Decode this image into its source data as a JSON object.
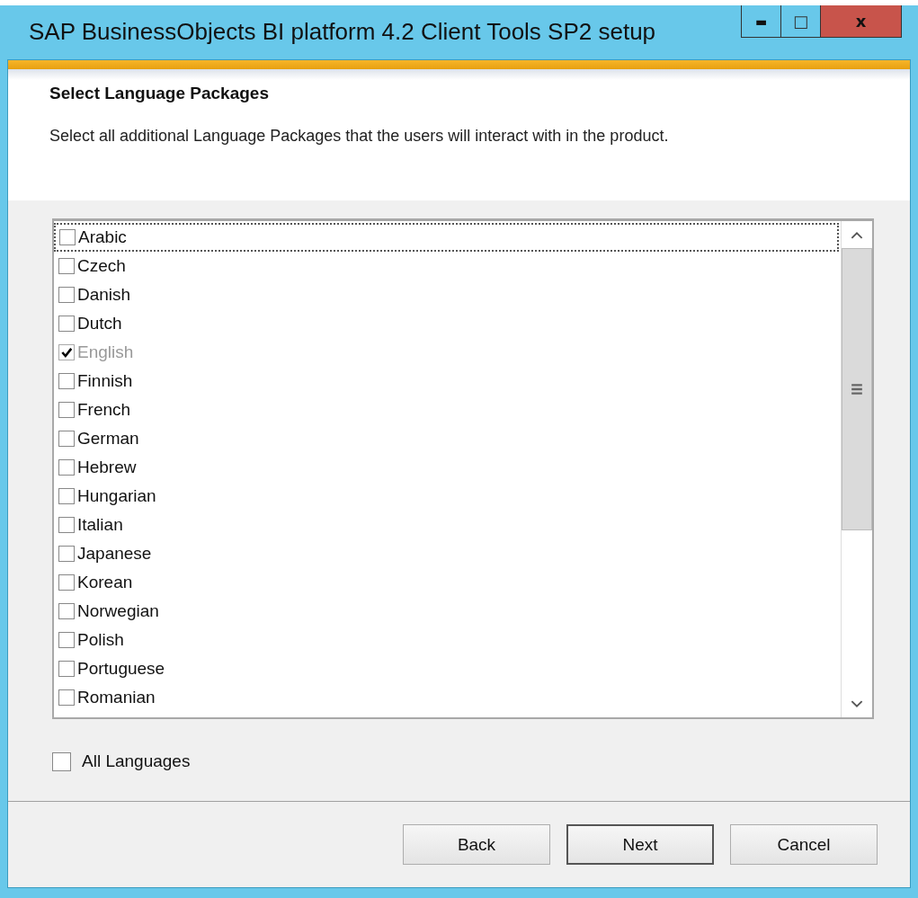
{
  "window": {
    "title": "SAP BusinessObjects BI platform 4.2 Client Tools SP2 setup",
    "controls": [
      {
        "kind": "minimize",
        "label": "▬"
      },
      {
        "kind": "maximize",
        "label": "□"
      },
      {
        "kind": "close",
        "label": "x"
      }
    ]
  },
  "header": {
    "title": "Select Language Packages",
    "description": "Select all additional Language Packages that the users will interact with in the product."
  },
  "languages": [
    {
      "label": "Arabic",
      "checked": false,
      "disabled": false,
      "focused": true
    },
    {
      "label": "Czech",
      "checked": false,
      "disabled": false,
      "focused": false
    },
    {
      "label": "Danish",
      "checked": false,
      "disabled": false,
      "focused": false
    },
    {
      "label": "Dutch",
      "checked": false,
      "disabled": false,
      "focused": false
    },
    {
      "label": "English",
      "checked": true,
      "disabled": true,
      "focused": false
    },
    {
      "label": "Finnish",
      "checked": false,
      "disabled": false,
      "focused": false
    },
    {
      "label": "French",
      "checked": false,
      "disabled": false,
      "focused": false
    },
    {
      "label": "German",
      "checked": false,
      "disabled": false,
      "focused": false
    },
    {
      "label": "Hebrew",
      "checked": false,
      "disabled": false,
      "focused": false
    },
    {
      "label": "Hungarian",
      "checked": false,
      "disabled": false,
      "focused": false
    },
    {
      "label": "Italian",
      "checked": false,
      "disabled": false,
      "focused": false
    },
    {
      "label": "Japanese",
      "checked": false,
      "disabled": false,
      "focused": false
    },
    {
      "label": "Korean",
      "checked": false,
      "disabled": false,
      "focused": false
    },
    {
      "label": "Norwegian",
      "checked": false,
      "disabled": false,
      "focused": false
    },
    {
      "label": "Polish",
      "checked": false,
      "disabled": false,
      "focused": false
    },
    {
      "label": "Portuguese",
      "checked": false,
      "disabled": false,
      "focused": false
    },
    {
      "label": "Romanian",
      "checked": false,
      "disabled": false,
      "focused": false
    }
  ],
  "all_languages": {
    "label": "All Languages",
    "checked": false
  },
  "buttons": [
    {
      "label": "Back",
      "default": false
    },
    {
      "label": "Next",
      "default": true
    },
    {
      "label": "Cancel",
      "default": false
    }
  ]
}
